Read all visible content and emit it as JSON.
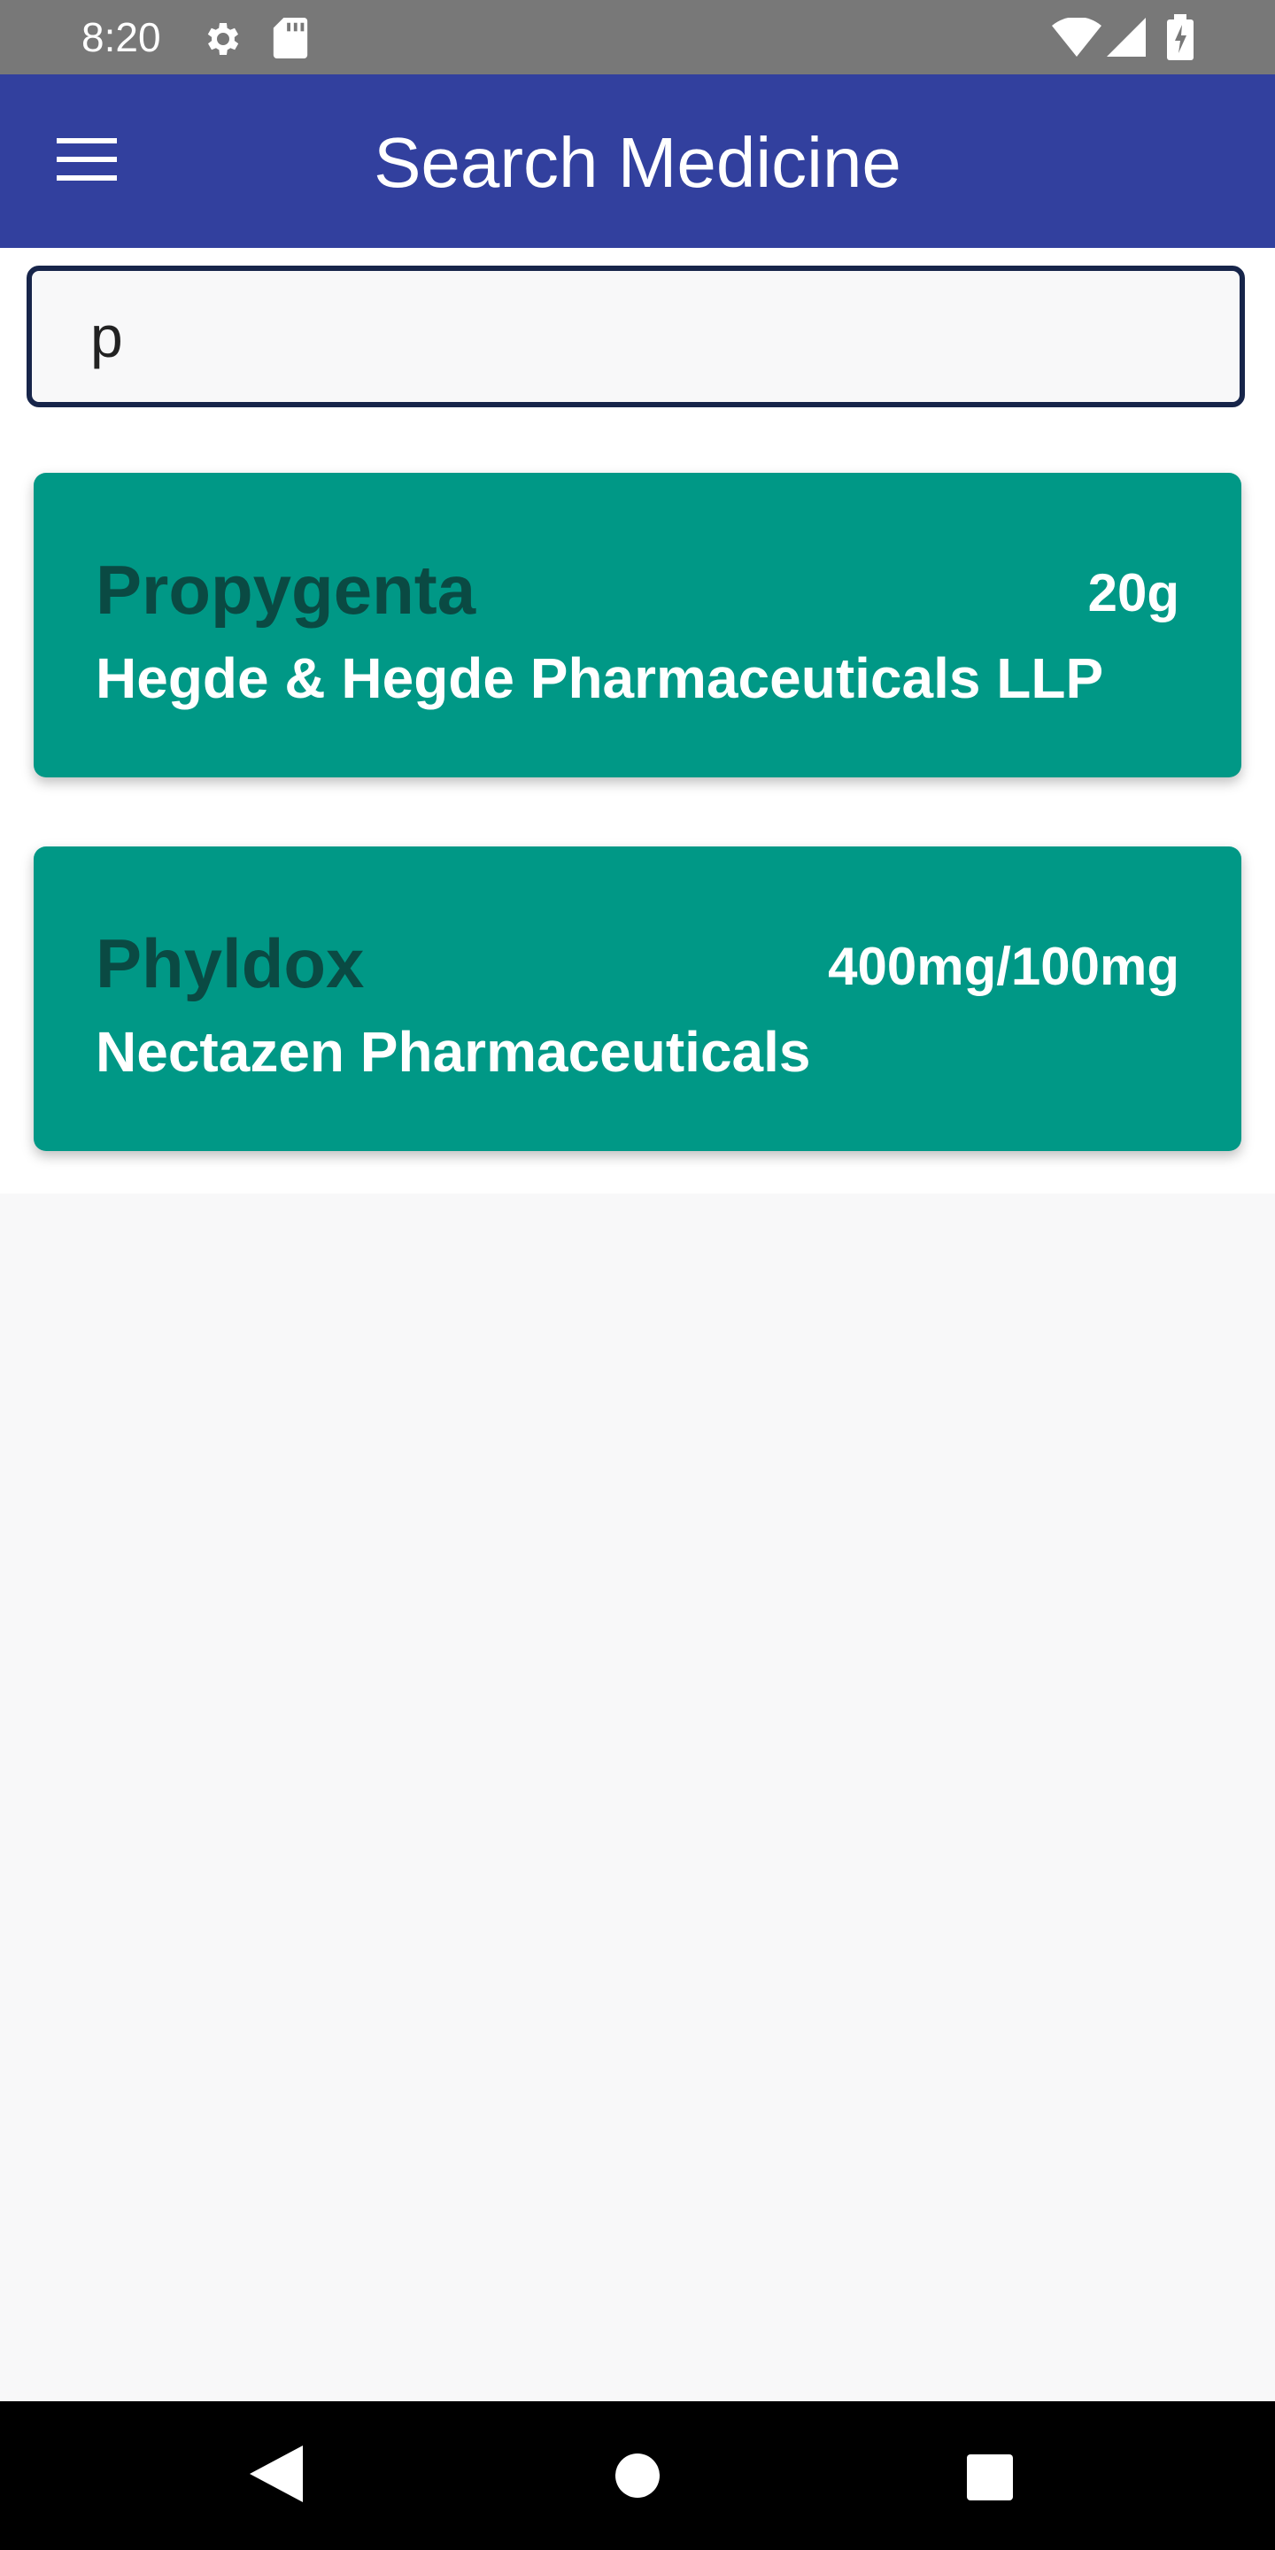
{
  "status_bar": {
    "time": "8:20",
    "icons": [
      "gear-icon",
      "sd-card-icon",
      "wifi-icon",
      "signal-icon",
      "battery-icon"
    ]
  },
  "app_bar": {
    "title": "Search Medicine",
    "menu_icon": "hamburger-menu-icon",
    "background": "#32409e"
  },
  "search": {
    "value": "p"
  },
  "results": [
    {
      "name": "Propygenta",
      "strength": "20g",
      "manufacturer": "Hegde & Hegde Pharmaceuticals LLP"
    },
    {
      "name": "Phyldox",
      "strength": "400mg/100mg",
      "manufacturer": "Nectazen Pharmaceuticals"
    }
  ],
  "colors": {
    "card": "#009886",
    "card_name": "#0a4a43",
    "search_border": "#17254a"
  },
  "nav_bar": {
    "icons": [
      "back-icon",
      "home-icon",
      "recents-icon"
    ]
  }
}
